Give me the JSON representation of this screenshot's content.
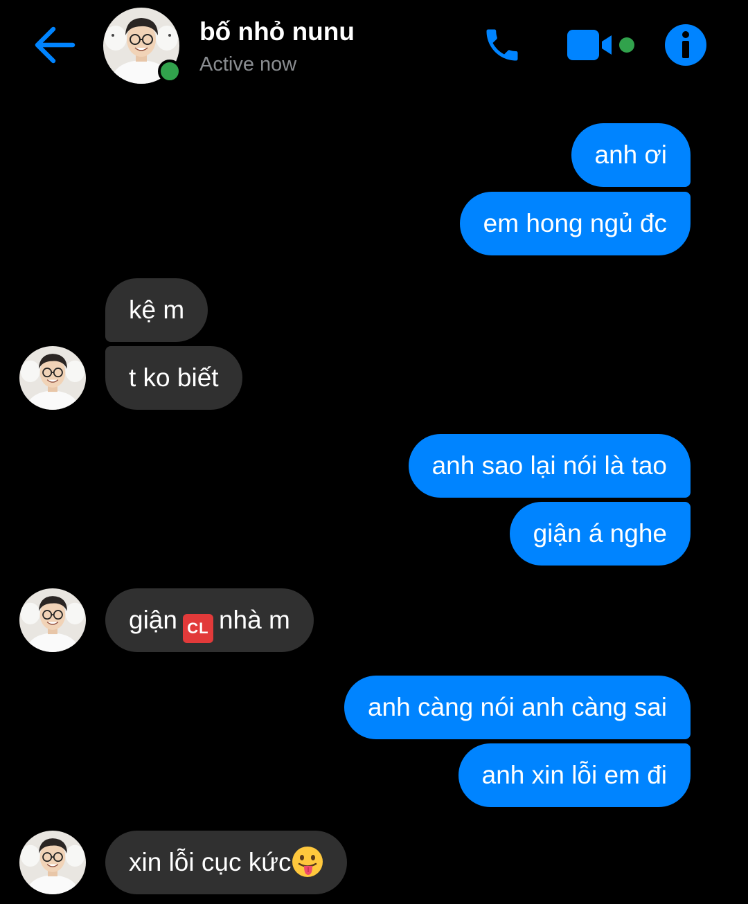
{
  "colors": {
    "accent": "#0084ff",
    "outgoing_bubble": "#0084ff",
    "incoming_bubble": "#303030",
    "background": "#000000",
    "online": "#31a24c",
    "status_text": "#8a8d91"
  },
  "header": {
    "back_icon": "arrow-left-icon",
    "contact_name": "bố nhỏ nunu",
    "status": "Active now",
    "actions": [
      {
        "icon": "phone-icon"
      },
      {
        "icon": "video-camera-icon"
      },
      {
        "icon": "info-icon"
      }
    ]
  },
  "messages": [
    {
      "from": "me",
      "text": "anh ơi"
    },
    {
      "from": "me",
      "text": "em hong ngủ đc"
    },
    {
      "from": "them",
      "text": "kệ m"
    },
    {
      "from": "them",
      "text": "t ko biết"
    },
    {
      "from": "me",
      "text": "anh sao lại nói là tao"
    },
    {
      "from": "me",
      "text": "giận á nghe"
    },
    {
      "from": "them",
      "text_before": "giận",
      "emoji_text": "CL",
      "text_after": "nhà m"
    },
    {
      "from": "me",
      "text": "anh càng nói anh càng sai"
    },
    {
      "from": "me",
      "text": "anh xin lỗi em đi"
    },
    {
      "from": "them",
      "text": "xin lỗi cục kức",
      "emoji": "face-with-tongue-emoji"
    }
  ]
}
